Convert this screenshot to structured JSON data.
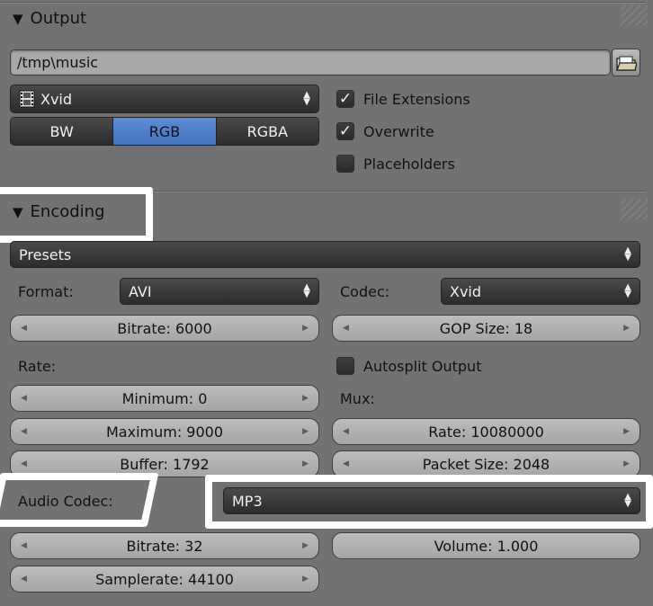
{
  "output": {
    "header": "Output",
    "path": "/tmp\\music",
    "format_dropdown": "Xvid",
    "color_modes": [
      "BW",
      "RGB",
      "RGBA"
    ],
    "active_color_mode": "RGB",
    "checkboxes": [
      {
        "label": "File Extensions",
        "checked": true
      },
      {
        "label": "Overwrite",
        "checked": true
      },
      {
        "label": "Placeholders",
        "checked": false
      }
    ]
  },
  "encoding": {
    "header": "Encoding",
    "presets": "Presets",
    "format_label": "Format:",
    "format_value": "AVI",
    "codec_label": "Codec:",
    "codec_value": "Xvid",
    "bitrate": "Bitrate: 6000",
    "gop_size": "GOP Size: 18",
    "rate_label": "Rate:",
    "autosplit_label": "Autosplit Output",
    "autosplit_checked": false,
    "minimum": "Minimum: 0",
    "maximum": "Maximum: 9000",
    "buffer": "Buffer: 1792",
    "mux_label": "Mux:",
    "mux_rate": "Rate: 10080000",
    "packet_size": "Packet Size: 2048",
    "audio_codec_label": "Audio Codec:",
    "audio_codec_value": "MP3",
    "audio_bitrate": "Bitrate: 32",
    "volume": "Volume: 1.000",
    "samplerate": "Samplerate: 44100"
  },
  "icons": {
    "collapse": "triangle-down-icon",
    "folder": "folder-icon",
    "film": "film-icon",
    "check": "checkmark-icon"
  },
  "colors": {
    "panel_bg": "#727272",
    "active_segment": "#5680cc",
    "highlight": "#ffffff"
  }
}
